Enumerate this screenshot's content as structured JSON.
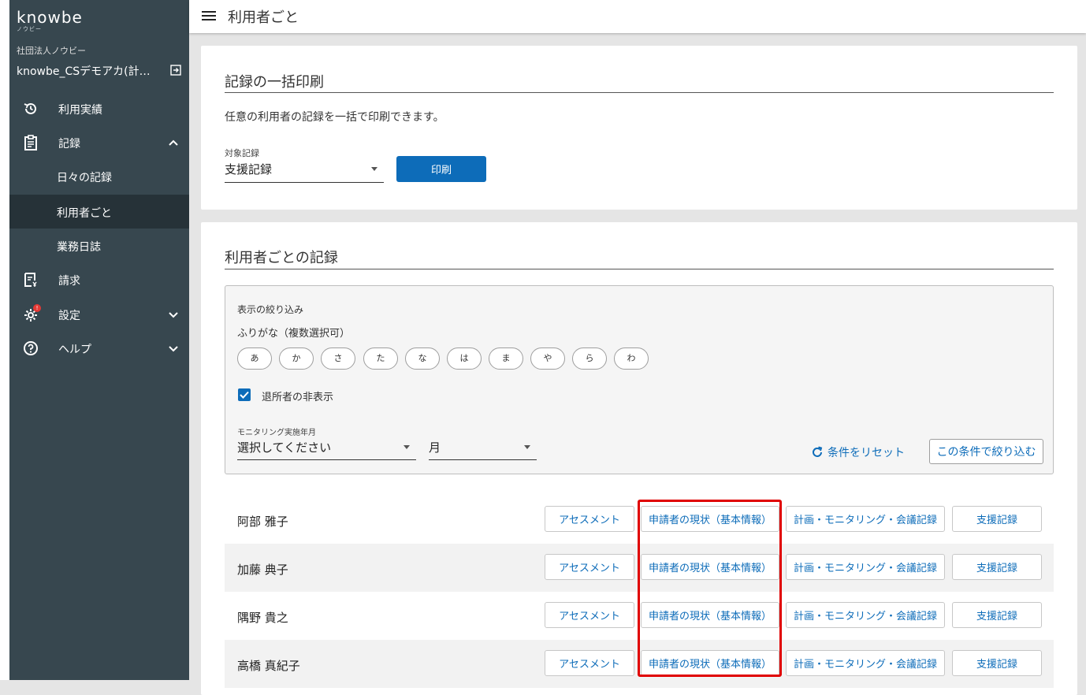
{
  "sidebar": {
    "logo": "knowbe",
    "logo_sub": "ノウビー",
    "org": "社団法人ノウビー",
    "facility": "knowbe_CSデモアカ(計画相談)",
    "items": [
      {
        "label": "利用実績"
      },
      {
        "label": "記録"
      },
      {
        "label": "日々の記録"
      },
      {
        "label": "利用者ごと"
      },
      {
        "label": "業務日誌"
      },
      {
        "label": "請求"
      },
      {
        "label": "設定",
        "badge": "!"
      },
      {
        "label": "ヘルプ"
      }
    ]
  },
  "header": {
    "title": "利用者ごと"
  },
  "bulk_print": {
    "heading": "記録の一括印刷",
    "description": "任意の利用者の記録を一括で印刷できます。",
    "target_label": "対象記録",
    "target_value": "支援記録",
    "print_label": "印刷"
  },
  "records": {
    "heading": "利用者ごとの記録",
    "filter": {
      "title": "表示の絞り込み",
      "furigana_label": "ふりがな（複数選択可）",
      "kana": [
        "あ",
        "か",
        "さ",
        "た",
        "な",
        "は",
        "ま",
        "や",
        "ら",
        "わ"
      ],
      "hide_retired_label": "退所者の非表示",
      "hide_retired_checked": true,
      "monitoring_label": "モニタリング実施年月",
      "year_placeholder": "選択してください",
      "month_placeholder": "月",
      "reset_label": "条件をリセット",
      "apply_label": "この条件で絞り込む"
    },
    "button_labels": {
      "assessment": "アセスメント",
      "applicant_status": "申請者の現状（基本情報）",
      "plan_monitoring": "計画・モニタリング・会議記録",
      "support_record": "支援記録"
    },
    "users": [
      {
        "name": "阿部 雅子"
      },
      {
        "name": "加藤 典子"
      },
      {
        "name": "隅野 貴之"
      },
      {
        "name": "高橋 真紀子"
      }
    ]
  }
}
